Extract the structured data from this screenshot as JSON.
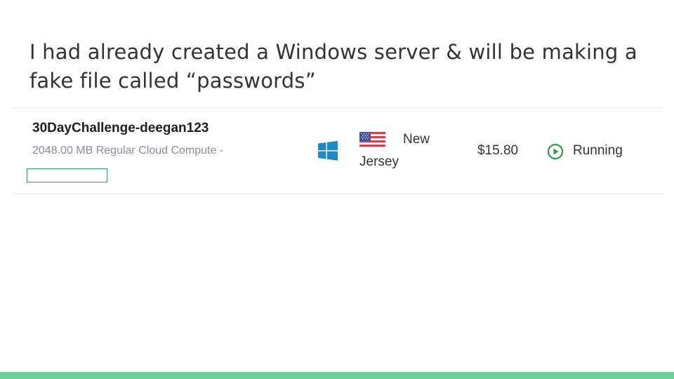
{
  "slide": {
    "title_line1": "I had already created a Windows server & will be making a",
    "title_line2": "fake file called “passwords”"
  },
  "server": {
    "name": "30DayChallenge-deegan123",
    "spec": "2048.00 MB Regular Cloud Compute -",
    "os_icon": "windows-icon",
    "location_flag": "us-flag-icon",
    "location_line1": "New",
    "location_line2": "Jersey",
    "price": "$15.80",
    "status_icon": "play-circle-icon",
    "status": "Running"
  },
  "colors": {
    "accent_bar": "#6fcf97",
    "status_green": "#2f9a4f",
    "windows_blue": "#1e88c7"
  }
}
